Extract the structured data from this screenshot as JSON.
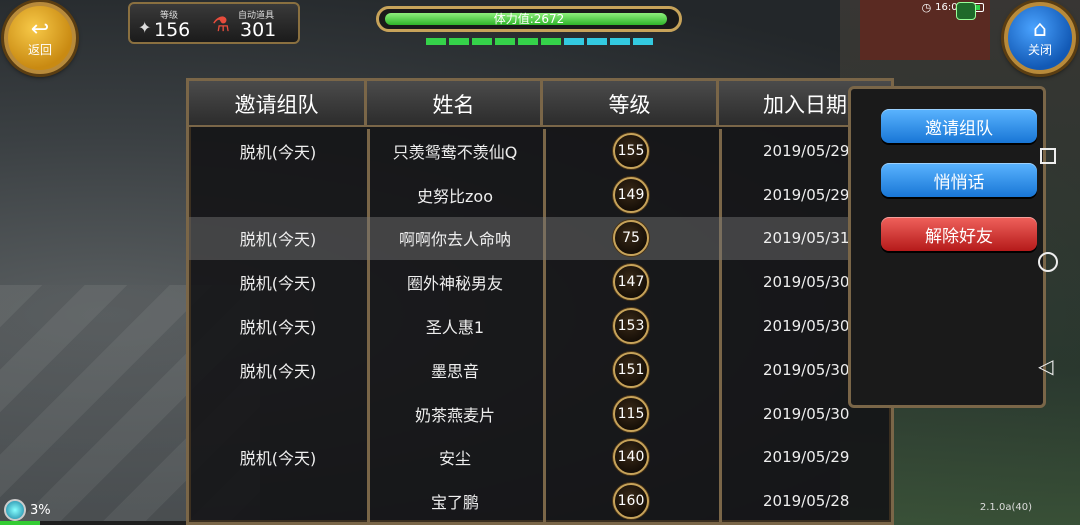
{
  "hud": {
    "back_label": "返回",
    "close_label": "关闭",
    "level_label": "等级",
    "level_value": "156",
    "item_label": "自动道具",
    "item_value": "301",
    "stamina_text": "体力值:2672",
    "stamina_fraction": 0.96,
    "clock": "16:09",
    "battery_percent": "3%",
    "version": "2.1.0a(40)"
  },
  "table": {
    "headers": [
      "邀请组队",
      "姓名",
      "等级",
      "加入日期"
    ],
    "rows": [
      {
        "status": "脱机(今天)",
        "name": "只羡鸳鸯不羡仙Q",
        "level": "155",
        "date": "2019/05/29"
      },
      {
        "status": "",
        "name": "史努比zoo",
        "level": "149",
        "date": "2019/05/29"
      },
      {
        "status": "脱机(今天)",
        "name": "啊啊你去人命呐",
        "level": "75",
        "date": "2019/05/31",
        "selected": true
      },
      {
        "status": "脱机(今天)",
        "name": "圈外神秘男友",
        "level": "147",
        "date": "2019/05/30"
      },
      {
        "status": "脱机(今天)",
        "name": "圣人惠1",
        "level": "153",
        "date": "2019/05/30"
      },
      {
        "status": "脱机(今天)",
        "name": "墨思音",
        "level": "151",
        "date": "2019/05/30"
      },
      {
        "status": "",
        "name": "奶茶燕麦片",
        "level": "115",
        "date": "2019/05/30"
      },
      {
        "status": "脱机(今天)",
        "name": "安尘",
        "level": "140",
        "date": "2019/05/29"
      },
      {
        "status": "",
        "name": "宝了鹏",
        "level": "160",
        "date": "2019/05/28"
      }
    ]
  },
  "menu": {
    "invite": "邀请组队",
    "whisper": "悄悄话",
    "remove": "解除好友"
  },
  "colors": {
    "frame": "#7a6648",
    "menu_blue": "#1876d6",
    "menu_red": "#b51a1a",
    "stamina_green": "#2fb52a"
  }
}
